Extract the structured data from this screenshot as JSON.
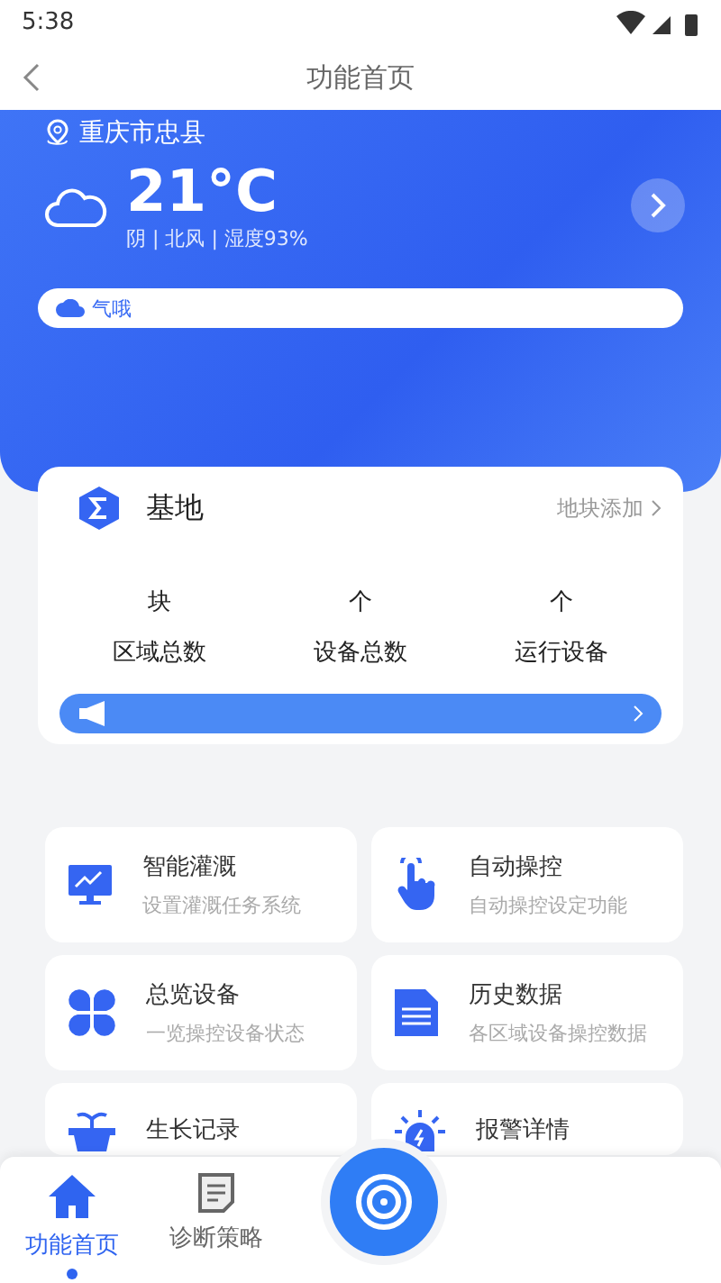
{
  "status_bar": {
    "time": "5:38"
  },
  "header": {
    "title": "功能首页"
  },
  "weather": {
    "location": "重庆市忠县",
    "temperature": "21°C",
    "details": "阴 | 北风 | 湿度93%",
    "notice": "气哦"
  },
  "base": {
    "title": "基地",
    "action": "地块添加",
    "stats": [
      {
        "unit": "块",
        "label": "区域总数"
      },
      {
        "unit": "个",
        "label": "设备总数"
      },
      {
        "unit": "个",
        "label": "运行设备"
      }
    ]
  },
  "features": [
    {
      "kind": "monitor",
      "title": "智能灌溉",
      "subtitle": "设置灌溉任务系统"
    },
    {
      "kind": "touch",
      "title": "自动操控",
      "subtitle": "自动操控设定功能"
    },
    {
      "kind": "grid",
      "title": "总览设备",
      "subtitle": "一览操控设备状态"
    },
    {
      "kind": "document",
      "title": "历史数据",
      "subtitle": "各区域设备操控数据"
    },
    {
      "kind": "plant",
      "title": "生长记录"
    },
    {
      "kind": "alarm",
      "title": "报警详情"
    }
  ],
  "bottom_nav": [
    {
      "kind": "home",
      "label": "功能首页",
      "selected": true
    },
    {
      "kind": "note",
      "label": "诊断策略",
      "selected": false
    }
  ]
}
